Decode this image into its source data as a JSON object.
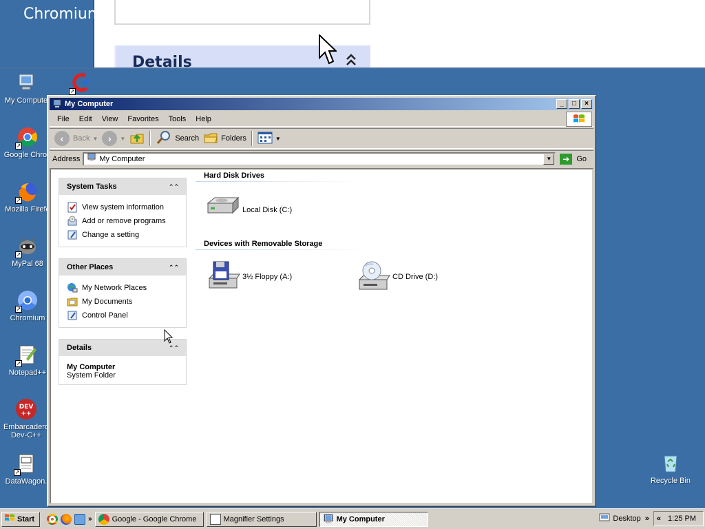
{
  "magnifier": {
    "title": "Chromium",
    "details_label": "Details",
    "chevron": "˄"
  },
  "desktop_icons": [
    {
      "label": "My Compute",
      "icon": "my-computer-icon"
    },
    {
      "label": "Google Chron",
      "icon": "chrome-icon"
    },
    {
      "label": "Mozilla Firefo",
      "icon": "firefox-icon"
    },
    {
      "label": "MyPal 68",
      "icon": "mypal-icon"
    },
    {
      "label": "Chromium",
      "icon": "chromium-icon"
    },
    {
      "label": "Notepad++",
      "icon": "notepadpp-icon"
    },
    {
      "label": "Embarcadero Dev-C++",
      "icon": "devcpp-icon"
    },
    {
      "label": "DataWagon.",
      "icon": "datawagon-icon"
    },
    {
      "label": "Recycle Bin",
      "icon": "recycle-bin-icon"
    }
  ],
  "window": {
    "title": "My Computer",
    "menu": [
      "File",
      "Edit",
      "View",
      "Favorites",
      "Tools",
      "Help"
    ],
    "toolbar": {
      "back": "Back",
      "search": "Search",
      "folders": "Folders"
    },
    "address": {
      "label": "Address",
      "value": "My Computer",
      "go": "Go"
    }
  },
  "left_panels": {
    "system_tasks": {
      "title": "System Tasks",
      "items": [
        "View system information",
        "Add or remove programs",
        "Change a setting"
      ]
    },
    "other_places": {
      "title": "Other Places",
      "items": [
        "My Network Places",
        "My Documents",
        "Control Panel"
      ]
    },
    "details": {
      "title": "Details",
      "name": "My Computer",
      "type": "System Folder"
    }
  },
  "groups": {
    "hard_disks": {
      "title": "Hard Disk Drives",
      "items": [
        "Local Disk (C:)"
      ]
    },
    "removable": {
      "title": "Devices with Removable Storage",
      "items": [
        "3½ Floppy (A:)",
        "CD Drive (D:)"
      ]
    }
  },
  "taskbar": {
    "start": "Start",
    "tasks": [
      "Google - Google Chrome",
      "Magnifier Settings",
      "My Computer"
    ],
    "desktop_label": "Desktop",
    "clock": "1:25 PM",
    "overflow": "»",
    "collapse": "«"
  },
  "colors": {
    "desktop": "#3a6ea5",
    "titlebar_start": "#0a246a",
    "titlebar_end": "#a6caf0",
    "face": "#d4d0c8"
  }
}
